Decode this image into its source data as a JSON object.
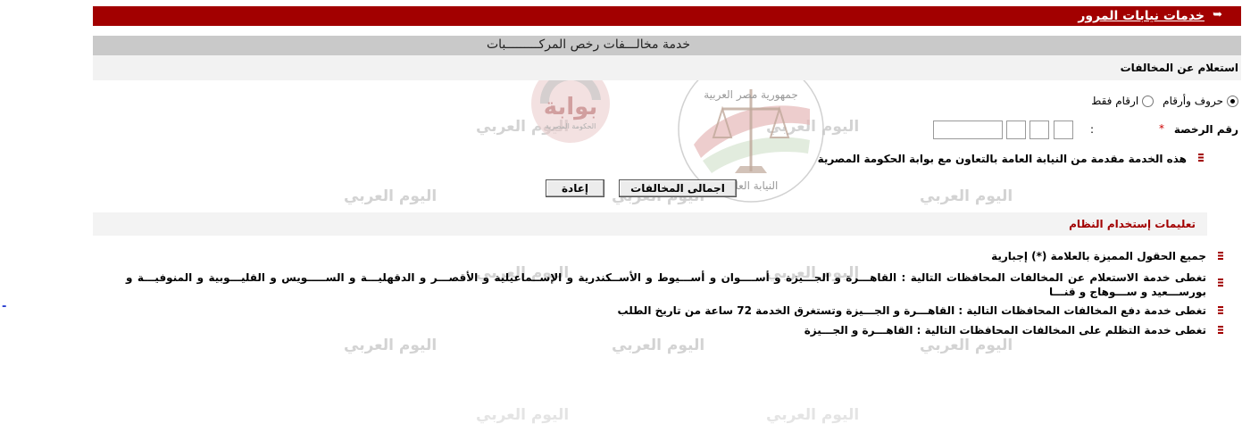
{
  "header": {
    "title": "خدمات نيابات المرور",
    "arrow_icon": "arrow-right-icon"
  },
  "service": {
    "title": "خدمة مخالـــفات رخص المركـــــــــبات"
  },
  "inquiry": {
    "title": "استعلام عن المخالفات"
  },
  "search_mode": {
    "options": [
      {
        "label": "حروف وأرقام",
        "checked": true
      },
      {
        "label": "ارقام فقط",
        "checked": false
      }
    ]
  },
  "license": {
    "label": "رقم الرخصة",
    "required_mark": "*",
    "separator": ":"
  },
  "note": {
    "text": "هذه الخدمة مقدمة من النيابة العامة بالتعاون مع بوابة الحكومة المصرية"
  },
  "buttons": {
    "total_label": "اجمالى المخالفات",
    "reset_label": "إعادة"
  },
  "instructions": {
    "title": "تعليمات إستخدام النظام",
    "items": [
      "جميع الحقول المميزة بالعلامة (*) إجبارية",
      "تغطى خدمة الاستعلام عن المخالفات المحافظات التالية : القاهـــرة و الجـــيزة و أســــوان و أســـيوط و الأســكندرية و الإســماعيلية و الأقصـــر و الدقهليـــة و الســـــويس و القليـــوبية و المنوفيـــة و بورســـعيد و ســـوهاج و قنـــا",
      "تغطى خدمة دفع المخالفات المحافظات التالية : القاهـــرة و الجـــيزة وتستغرق الخدمة 72 ساعة من تاريخ الطلب",
      "تغطى خدمة التظلم على المخالفات المحافظات التالية : القاهـــرة و الجـــيزة"
    ]
  },
  "watermark": {
    "text": "اليوم العربي"
  },
  "logos": {
    "gov_portal": {
      "text": "بوابة",
      "subtext": "الحكومة المصرية"
    },
    "seal": {
      "top_text": "جمهورية مصر العربية",
      "bottom_text": "النيابة العامة"
    }
  },
  "side_mark": "-"
}
